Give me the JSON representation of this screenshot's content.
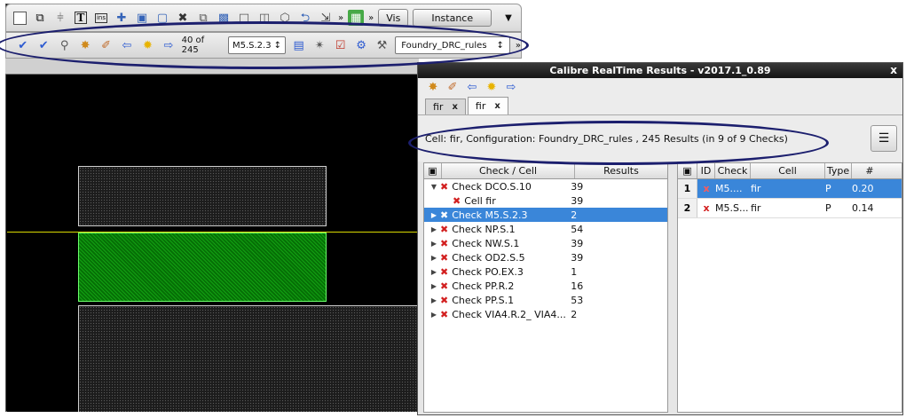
{
  "editor": {
    "toolbar1": {
      "icons": [
        "select-box-icon",
        "layer-icon",
        "path-icon",
        "text-icon",
        "instance-icon",
        "move-icon",
        "copy-icon",
        "stretch-icon",
        "delete-icon",
        "cut-icon",
        "merge-icon",
        "flatten-icon",
        "ruler-icon",
        "polygon-icon",
        "arrow-icon",
        "more-icon"
      ],
      "more_label": "»",
      "vis_label": "Vis",
      "instance_label": "Instance",
      "dropdown_arrow": "▼"
    },
    "toolbar2": {
      "result_counter": "40 of 245",
      "check_select": "M5.S.2.3",
      "rules_select": "Foundry_DRC_rules",
      "more_label": "»"
    }
  },
  "results_window": {
    "title": "Calibre RealTime Results - v2017.1_0.89",
    "close_label": "x",
    "tabs": [
      {
        "label": "fir",
        "close": "x"
      },
      {
        "label": "fir",
        "close": "x"
      }
    ],
    "summary": "Cell: fir, Configuration: Foundry_DRC_rules , 245 Results (in 9 of 9 Checks)",
    "check_table": {
      "headers": {
        "check": "Check / Cell",
        "results": "Results"
      },
      "rows": [
        {
          "arrow": "▼",
          "name": "Check DCO.S.10",
          "value": "39",
          "indent": false,
          "selected": false
        },
        {
          "arrow": "",
          "name": "Cell fir",
          "value": "39",
          "indent": true,
          "selected": false
        },
        {
          "arrow": "▶",
          "name": "Check M5.S.2.3",
          "value": "2",
          "indent": false,
          "selected": true
        },
        {
          "arrow": "▶",
          "name": "Check NP.S.1",
          "value": "54",
          "indent": false,
          "selected": false
        },
        {
          "arrow": "▶",
          "name": "Check NW.S.1",
          "value": "39",
          "indent": false,
          "selected": false
        },
        {
          "arrow": "▶",
          "name": "Check OD2.S.5",
          "value": "39",
          "indent": false,
          "selected": false
        },
        {
          "arrow": "▶",
          "name": "Check PO.EX.3",
          "value": "1",
          "indent": false,
          "selected": false
        },
        {
          "arrow": "▶",
          "name": "Check PP.R.2",
          "value": "16",
          "indent": false,
          "selected": false
        },
        {
          "arrow": "▶",
          "name": "Check PP.S.1",
          "value": "53",
          "indent": false,
          "selected": false
        },
        {
          "arrow": "▶",
          "name": "Check VIA4.R.2_ VIA4...",
          "value": "2",
          "indent": false,
          "selected": false
        }
      ]
    },
    "detail_table": {
      "headers": {
        "id": "ID",
        "check": "Check",
        "cell": "Cell",
        "type": "Type",
        "value": "#"
      },
      "rows": [
        {
          "index": "1",
          "flag": "x",
          "check": "M5....",
          "cell": "fir",
          "type": "P",
          "value": "0.20",
          "selected": true
        },
        {
          "index": "2",
          "flag": "x",
          "check": "M5.S...",
          "cell": "fir",
          "type": "P",
          "value": "0.14",
          "selected": false
        }
      ]
    }
  },
  "colors": {
    "selection": "#3a86d9",
    "error_mark": "#d21f1f",
    "annotation_oval": "#1c1f6e",
    "layout_green": "#0a8a0a",
    "guide_line": "#d8d800"
  }
}
